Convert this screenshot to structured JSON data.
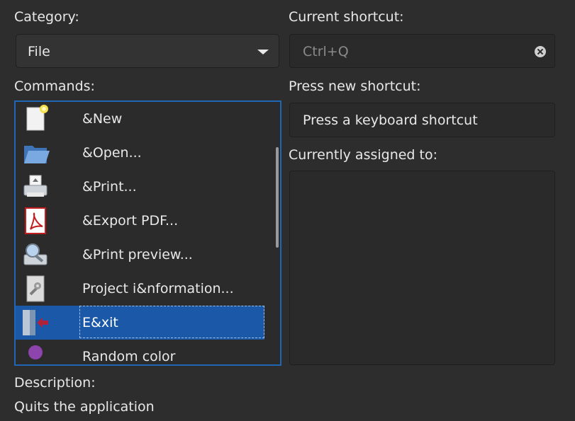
{
  "category": {
    "label": "Category:",
    "selected": "File"
  },
  "current_shortcut": {
    "label": "Current shortcut:",
    "placeholder": "Ctrl+Q"
  },
  "commands": {
    "label": "Commands:",
    "items": [
      {
        "label": "&New",
        "icon": "new-document-icon"
      },
      {
        "label": "&Open...",
        "icon": "open-folder-icon"
      },
      {
        "label": "&Print...",
        "icon": "printer-icon"
      },
      {
        "label": "&Export PDF...",
        "icon": "pdf-icon"
      },
      {
        "label": "&Print preview...",
        "icon": "print-preview-icon"
      },
      {
        "label": "Project i&nformation...",
        "icon": "project-info-icon"
      },
      {
        "label": "E&xit",
        "icon": "exit-icon",
        "selected": true
      },
      {
        "label": "Random color",
        "icon": "user-icon"
      }
    ]
  },
  "new_shortcut": {
    "label": "Press new shortcut:",
    "prompt": "Press a keyboard shortcut"
  },
  "assigned": {
    "label": "Currently assigned to:"
  },
  "description": {
    "label": "Description:",
    "text": "Quits the application"
  },
  "colors": {
    "accent": "#1b59a8",
    "focus_border": "#1f66b5",
    "background": "#2d2d2d"
  }
}
